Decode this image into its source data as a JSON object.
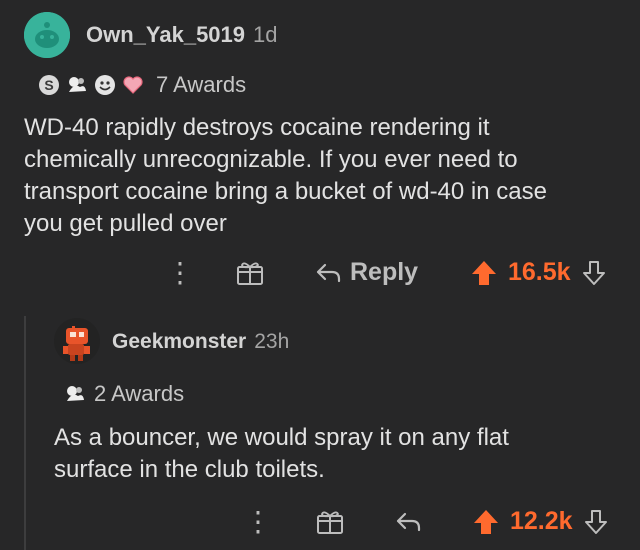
{
  "comment1": {
    "username": "Own_Yak_5019",
    "age": "1d",
    "awards_label": "7 Awards",
    "award_icons": [
      "silver-award-icon",
      "wholesome-hug-award-icon",
      "face-award-icon",
      "heart-award-icon"
    ],
    "body": "WD-40 rapidly destroys cocaine rendering it\nchemically unrecognizable. If you ever need to\ntransport cocaine bring a bucket of wd-40 in case\nyou get pulled over",
    "reply_label": "Reply",
    "score": "16.5k"
  },
  "comment2": {
    "username": "Geekmonster",
    "age": "23h",
    "awards_label": "2 Awards",
    "award_icons": [
      "wholesome-hug-award-icon"
    ],
    "body": "As a bouncer, we would spray it on any flat\nsurface in the club toilets.",
    "score": "12.2k"
  },
  "colors": {
    "background": "#272728",
    "upvote": "#ff6a2e",
    "avatar1": "#38b39b",
    "avatar2_accent": "#e8542a"
  }
}
